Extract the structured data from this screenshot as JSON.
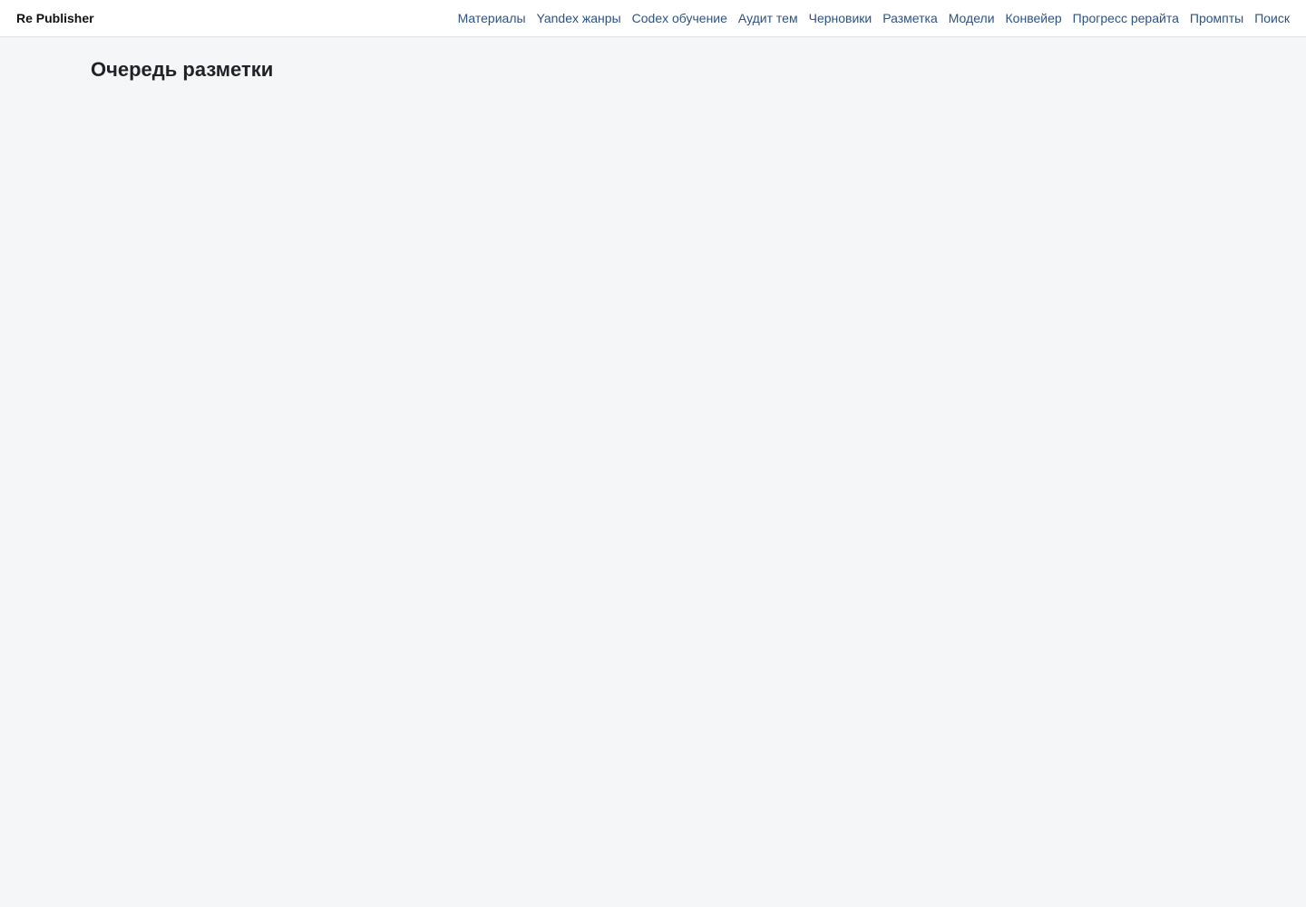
{
  "app": {
    "brand": "Re Publisher"
  },
  "nav": {
    "items": [
      {
        "label": "Материалы"
      },
      {
        "label": "Yandex жанры"
      },
      {
        "label": "Codex обучение"
      },
      {
        "label": "Аудит тем"
      },
      {
        "label": "Черновики"
      },
      {
        "label": "Разметка"
      },
      {
        "label": "Модели"
      },
      {
        "label": "Конвейер"
      },
      {
        "label": "Прогресс рерайта"
      },
      {
        "label": "Промпты"
      },
      {
        "label": "Поиск"
      }
    ]
  },
  "page": {
    "title": "Очередь разметки"
  },
  "colors": {
    "background": "#f4f6f8",
    "header_background": "#ffffff",
    "nav_link": "#2c5282",
    "title": "#1f2328"
  }
}
